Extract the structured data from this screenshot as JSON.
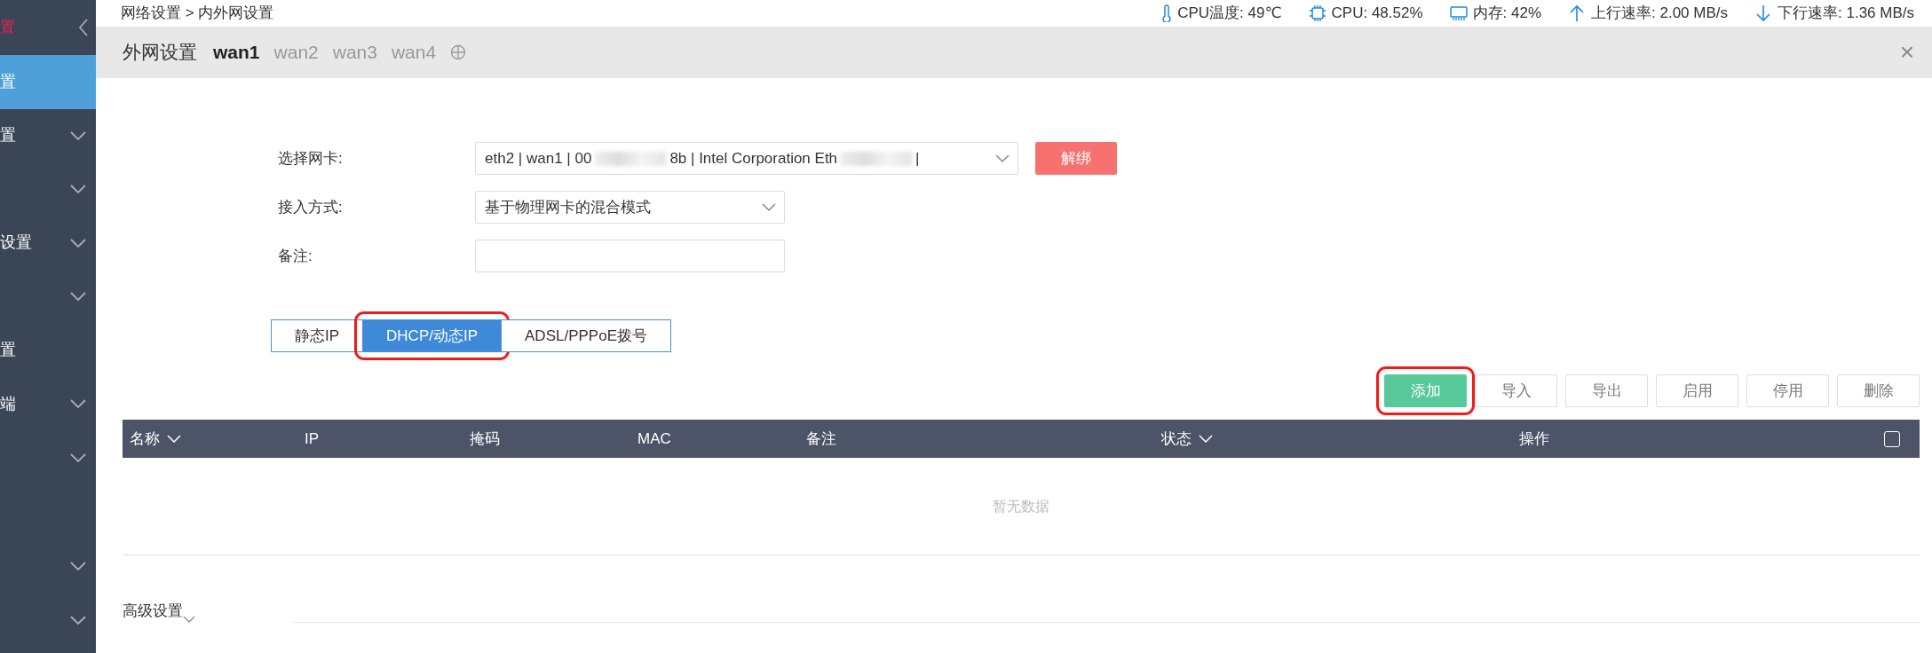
{
  "sidebar": {
    "title": "置",
    "items": [
      {
        "label": "置",
        "selected": true,
        "expandable": false
      },
      {
        "label": "置",
        "selected": false,
        "expandable": true
      },
      {
        "selected": false,
        "expandable": true
      },
      {
        "label": "设置",
        "selected": false,
        "expandable": true
      },
      {
        "selected": false,
        "expandable": true
      },
      {
        "label": "置",
        "selected": false,
        "expandable": false
      },
      {
        "label": "端",
        "selected": false,
        "expandable": true
      },
      {
        "selected": false,
        "expandable": true
      },
      {
        "selected": false,
        "expandable": true
      },
      {
        "selected": false,
        "expandable": true
      }
    ]
  },
  "breadcrumb": "网络设置 > 内外网设置",
  "stats": [
    {
      "kind": "temperature",
      "text": "CPU温度: 49℃"
    },
    {
      "kind": "cpu",
      "text": "CPU: 48.52%"
    },
    {
      "kind": "memory",
      "text": "内存: 42%"
    },
    {
      "kind": "upload",
      "text": "上行速率: 2.00 MB/s"
    },
    {
      "kind": "download",
      "text": "下行速率: 1.36 MB/s"
    }
  ],
  "tab_bar": {
    "title": "外网设置",
    "tabs": [
      {
        "label": "wan1",
        "selected": true
      },
      {
        "label": "wan2",
        "selected": false
      },
      {
        "label": "wan3",
        "selected": false
      },
      {
        "label": "wan4",
        "selected": false
      }
    ],
    "close": "×"
  },
  "form": [
    {
      "kind": "select",
      "label": "选择网卡:",
      "parts": [
        "eth2 | wan1 | 00",
        "8b | Intel Corporation Eth",
        "|"
      ],
      "button": "解绑"
    },
    {
      "kind": "select",
      "label": "接入方式:",
      "value": "基于物理网卡的混合模式"
    },
    {
      "kind": "input",
      "label": "备注:"
    }
  ],
  "modes": [
    {
      "label": "静态IP",
      "selected": false,
      "highlighted": false
    },
    {
      "label": "DHCP/动态IP",
      "selected": true,
      "highlighted": true
    },
    {
      "label": "ADSL/PPPoE拨号",
      "selected": false,
      "highlighted": false
    }
  ],
  "actions": [
    {
      "label": "添加",
      "disabled": false,
      "highlighted": true
    },
    {
      "label": "导入",
      "disabled": true,
      "highlighted": false
    },
    {
      "label": "导出",
      "disabled": true,
      "highlighted": false
    },
    {
      "label": "启用",
      "disabled": true,
      "highlighted": false
    },
    {
      "label": "停用",
      "disabled": true,
      "highlighted": false
    },
    {
      "label": "删除",
      "disabled": true,
      "highlighted": false
    }
  ],
  "table": {
    "columns": [
      {
        "label": "名称",
        "sortable": true
      },
      {
        "label": "IP",
        "sortable": false
      },
      {
        "label": "掩码",
        "sortable": false
      },
      {
        "label": "MAC",
        "sortable": false
      },
      {
        "label": "备注",
        "sortable": false
      },
      {
        "label": "状态",
        "sortable": true
      },
      {
        "label": "操作",
        "sortable": false
      }
    ],
    "select_all": {
      "checked": false
    },
    "empty_text": "暂无数据"
  },
  "advanced": "高级设置"
}
